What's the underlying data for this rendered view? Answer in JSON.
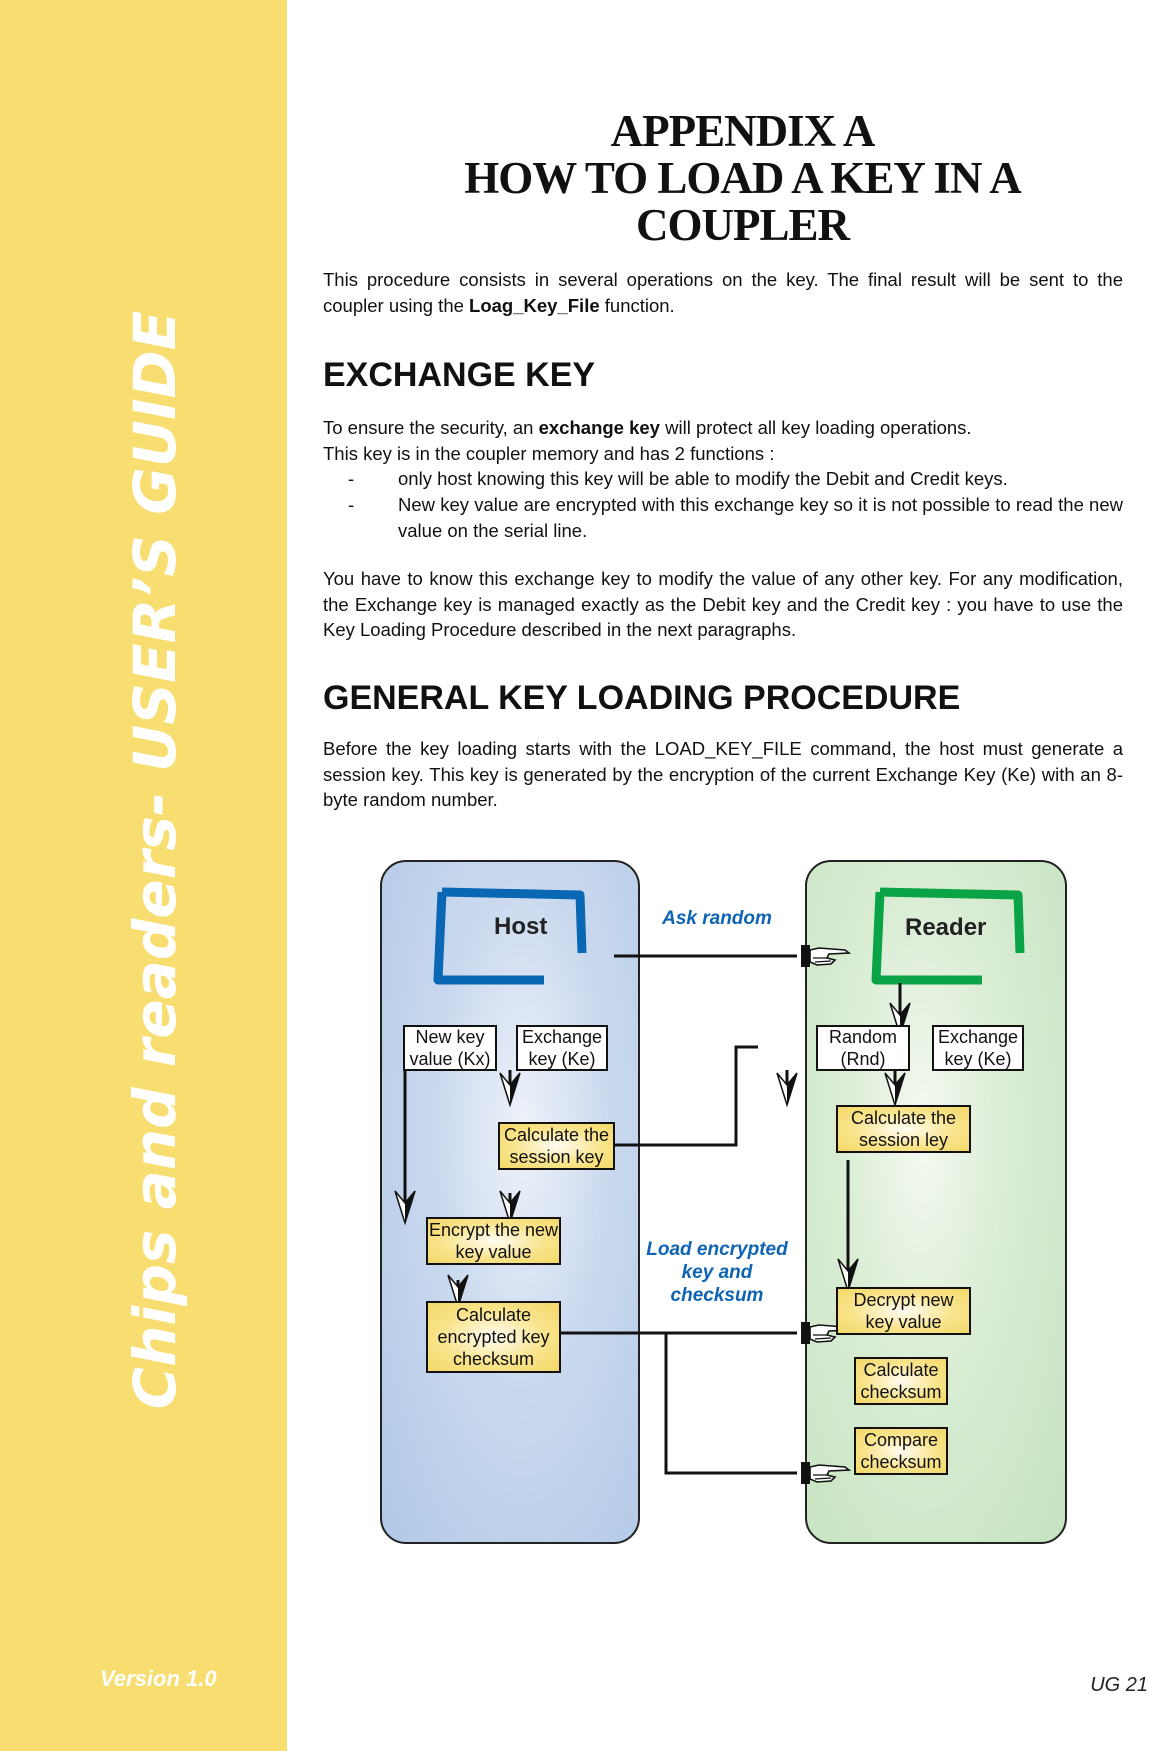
{
  "sidebar": {
    "title": "Chips and readers- USER’S GUIDE",
    "version": "Version 1.0",
    "background_color": "#f8de70"
  },
  "footer": {
    "page_number": "UG 21"
  },
  "header": {
    "line1": "APPENDIX A",
    "line2": "HOW TO LOAD A KEY IN A",
    "line3": "COUPLER"
  },
  "intro": {
    "before": "This procedure consists in several operations on the key. The final result will be sent to the coupler using the ",
    "bold": "Loag_Key_File",
    "after": " function."
  },
  "exchange_key": {
    "heading": "EXCHANGE KEY",
    "p1_before": "To ensure the security, an ",
    "p1_bold": "exchange key",
    "p1_after": " will protect all key loading operations.",
    "p2": "This key is in the coupler memory and has 2 functions :",
    "bullets": [
      "only host knowing this key will be able to modify the Debit and Credit keys.",
      "New key value are encrypted with this exchange key so it is not possible to read the new value on the serial line."
    ],
    "bullet_marker": "-",
    "p3": "You have to know this exchange key to modify the value of any other key. For any modification, the Exchange key is managed exactly as the Debit key and the Credit key : you have to use the Key Loading Procedure described in the next paragraphs."
  },
  "general": {
    "heading": "GENERAL KEY LOADING PROCEDURE",
    "p1": "Before the key loading starts with the LOAD_KEY_FILE command, the host must generate a session key. This key is generated by the encryption of the current Exchange Key (Ke) with an 8-byte random number."
  },
  "diagram": {
    "host": {
      "title": "Host",
      "color": "#0a67b4",
      "new_key": "New key value (Kx)",
      "exchange_key": "Exchange key (Ke)",
      "calc_session": "Calculate the session key",
      "encrypt": "Encrypt the new key value",
      "calc_checksum": "Calculate encrypted key checksum"
    },
    "reader": {
      "title": "Reader",
      "color": "#0aa446",
      "random": "Random (Rnd)",
      "exchange_key": "Exchange key (Ke)",
      "calc_session": "Calculate the session ley",
      "decrypt": "Decrypt new key value",
      "calc_checksum": "Calculate checksum",
      "compare": "Compare checksum"
    },
    "labels": {
      "ask_random": "Ask random",
      "load": "Load encrypted key and checksum"
    }
  }
}
